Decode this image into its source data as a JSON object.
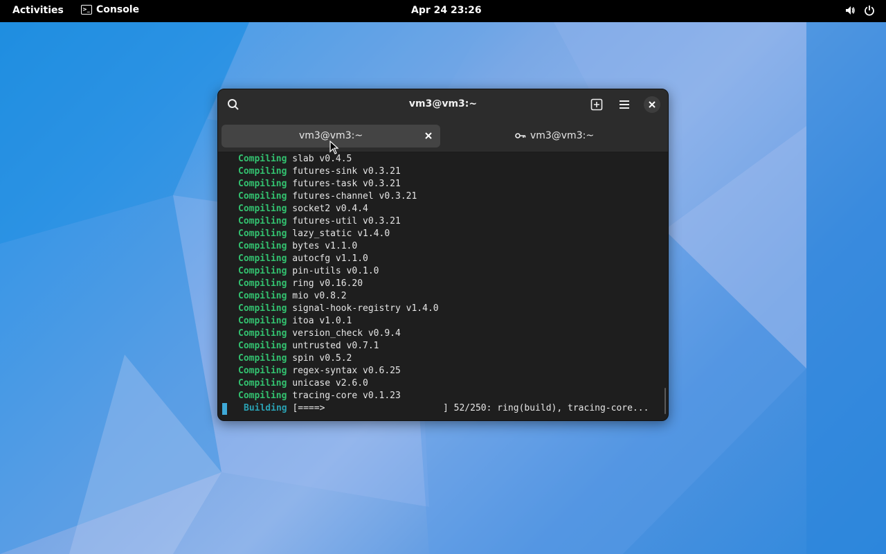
{
  "topbar": {
    "activities": "Activities",
    "app_name": "Console",
    "clock": "Apr 24  23:26",
    "icons": [
      "volume-icon",
      "power-icon"
    ]
  },
  "window": {
    "title": "vm3@vm3:~",
    "icons": [
      "search-icon",
      "new-tab-icon",
      "hamburger-menu-icon",
      "close-icon"
    ],
    "tabs": [
      {
        "label": "vm3@vm3:~",
        "active": true
      },
      {
        "label": "vm3@vm3:~",
        "active": false,
        "icon": "key-icon"
      }
    ]
  },
  "terminal": {
    "lines": [
      {
        "keyword": "Compiling",
        "text": "slab v0.4.5"
      },
      {
        "keyword": "Compiling",
        "text": "futures-sink v0.3.21"
      },
      {
        "keyword": "Compiling",
        "text": "futures-task v0.3.21"
      },
      {
        "keyword": "Compiling",
        "text": "futures-channel v0.3.21"
      },
      {
        "keyword": "Compiling",
        "text": "socket2 v0.4.4"
      },
      {
        "keyword": "Compiling",
        "text": "futures-util v0.3.21"
      },
      {
        "keyword": "Compiling",
        "text": "lazy_static v1.4.0"
      },
      {
        "keyword": "Compiling",
        "text": "bytes v1.1.0"
      },
      {
        "keyword": "Compiling",
        "text": "autocfg v1.1.0"
      },
      {
        "keyword": "Compiling",
        "text": "pin-utils v0.1.0"
      },
      {
        "keyword": "Compiling",
        "text": "ring v0.16.20"
      },
      {
        "keyword": "Compiling",
        "text": "mio v0.8.2"
      },
      {
        "keyword": "Compiling",
        "text": "signal-hook-registry v1.4.0"
      },
      {
        "keyword": "Compiling",
        "text": "itoa v1.0.1"
      },
      {
        "keyword": "Compiling",
        "text": "version_check v0.9.4"
      },
      {
        "keyword": "Compiling",
        "text": "untrusted v0.7.1"
      },
      {
        "keyword": "Compiling",
        "text": "spin v0.5.2"
      },
      {
        "keyword": "Compiling",
        "text": "regex-syntax v0.6.25"
      },
      {
        "keyword": "Compiling",
        "text": "unicase v2.6.0"
      },
      {
        "keyword": "Compiling",
        "text": "tracing-core v0.1.23"
      }
    ],
    "status": {
      "keyword": "Building",
      "bar": "[====>",
      "right": "] 52/250: ring(build), tracing-core..."
    }
  },
  "colors": {
    "compiling": "#33c270",
    "building": "#2aa1b3",
    "cursor": "#3fa9d8"
  }
}
